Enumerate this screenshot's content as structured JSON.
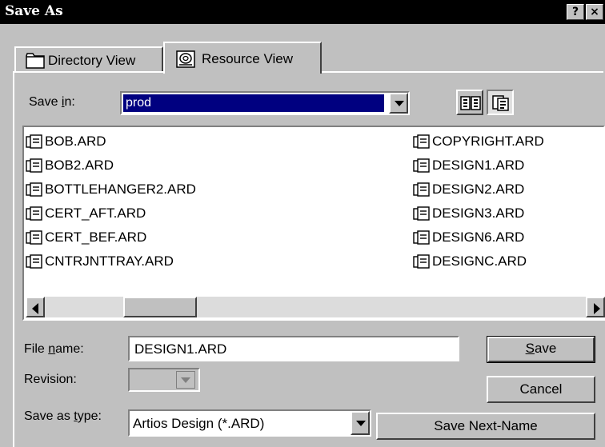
{
  "window": {
    "title": "Save As",
    "help_glyph": "?",
    "close_glyph": "×"
  },
  "tabs": [
    {
      "label": "Directory View",
      "icon": "folder-icon"
    },
    {
      "label": "Resource View",
      "icon": "resource-icon",
      "active": true
    }
  ],
  "save_in": {
    "label_pre": "Save ",
    "label_u": "i",
    "label_post": "n:",
    "value": "prod"
  },
  "view_buttons": [
    {
      "icon": "list-view-icon"
    },
    {
      "icon": "details-view-icon"
    }
  ],
  "files": {
    "left": [
      "BOB.ARD",
      "BOB2.ARD",
      "BOTTLEHANGER2.ARD",
      "CERT_AFT.ARD",
      "CERT_BEF.ARD",
      "CNTRJNTTRAY.ARD"
    ],
    "right": [
      "COPYRIGHT.ARD",
      "DESIGN1.ARD",
      "DESIGN2.ARD",
      "DESIGN3.ARD",
      "DESIGN6.ARD",
      "DESIGNC.ARD"
    ]
  },
  "file_name": {
    "label_pre": "File ",
    "label_u": "n",
    "label_post": "ame:",
    "value": "DESIGN1.ARD"
  },
  "revision": {
    "label": "Revision:",
    "value": ""
  },
  "save_as_type": {
    "label_pre": "Save as ",
    "label_u": "t",
    "label_post": "ype:",
    "value": "Artios Design (*.ARD)"
  },
  "buttons": {
    "save_u": "S",
    "save_rest": "ave",
    "cancel": "Cancel",
    "save_next": "Save Next-Name"
  },
  "colors": {
    "selection": "#000080",
    "face": "#c0c0c0",
    "title_bar": "#000000"
  }
}
